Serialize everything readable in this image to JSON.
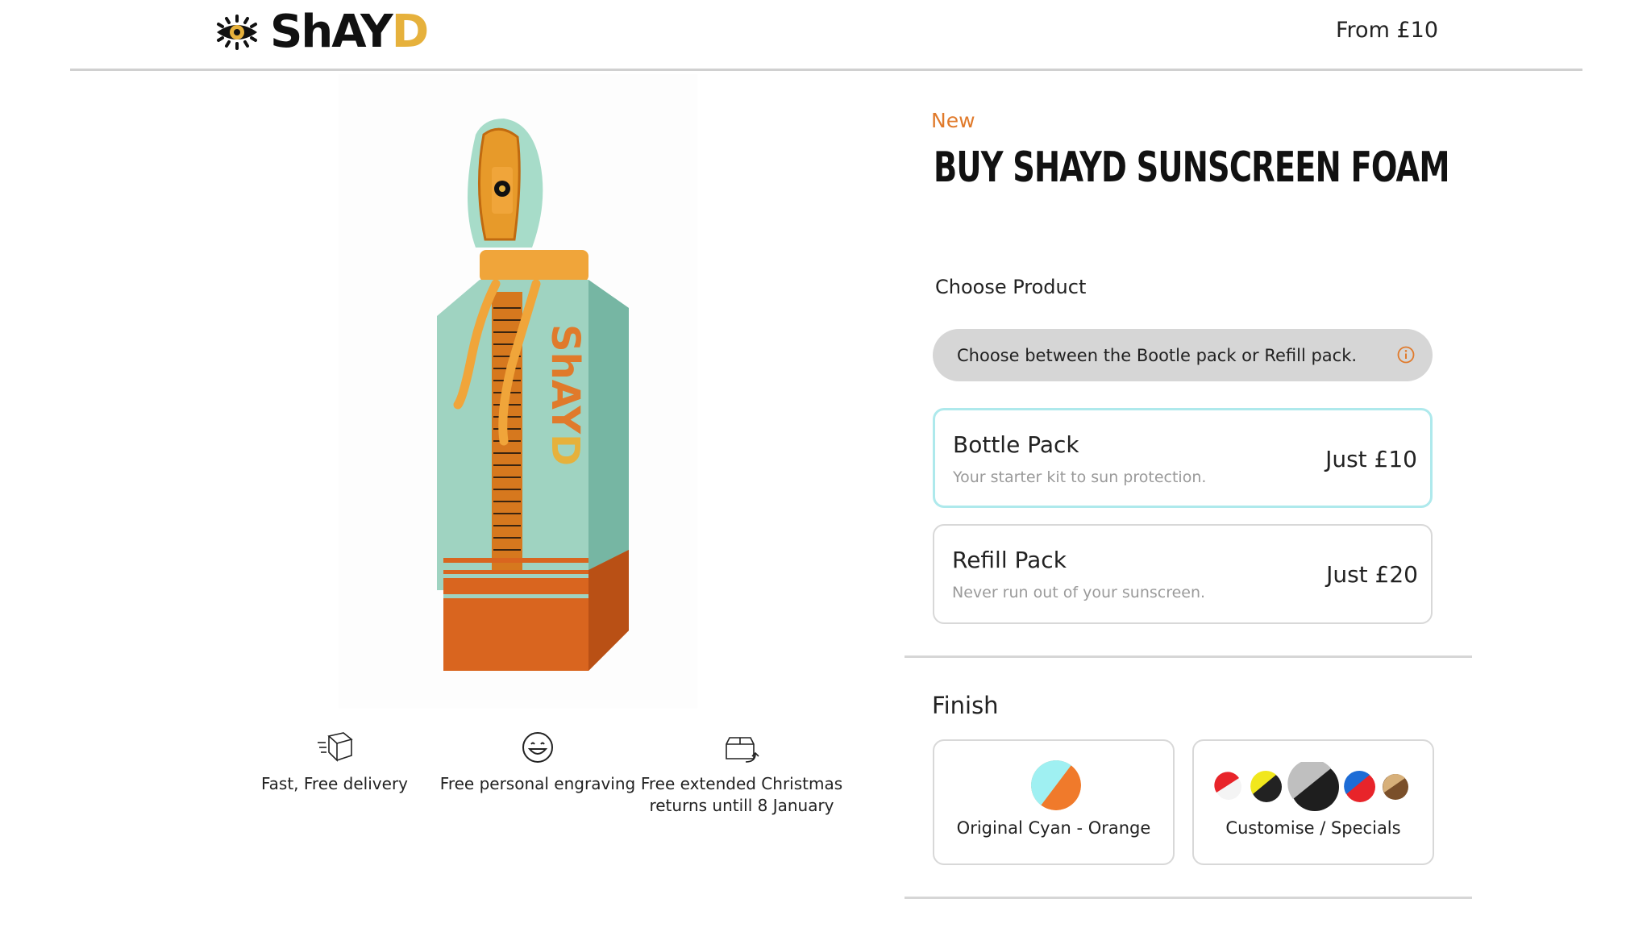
{
  "header": {
    "brand": "ShAYD",
    "brand_main": "ShAY",
    "brand_accent": "D",
    "from_price": "From £10"
  },
  "product": {
    "tag": "New",
    "title": "BUY SHAYD SUNSCREEN FOAM",
    "image_icon": "sunscreen-bottle-image"
  },
  "features": [
    {
      "icon": "delivery-box-icon",
      "line1": "Fast, Free delivery",
      "line2": ""
    },
    {
      "icon": "smiley-face-icon",
      "line1": "Free personal engraving",
      "line2": ""
    },
    {
      "icon": "return-box-icon",
      "line1": "Free extended Christmas",
      "line2": "returns untill 8 January"
    }
  ],
  "choose": {
    "label": "Choose Product",
    "info_text": "Choose between the Bootle pack or Refill pack."
  },
  "packs": [
    {
      "name": "Bottle Pack",
      "desc": "Your starter kit to sun protection.",
      "price": "Just £10",
      "selected": true
    },
    {
      "name": "Refill Pack",
      "desc": "Never run out of your sunscreen.",
      "price": "Just £20",
      "selected": false
    }
  ],
  "finish": {
    "label": "Finish",
    "options": [
      {
        "label": "Original  Cyan - Orange"
      },
      {
        "label": "Customise / Specials"
      }
    ]
  },
  "colors": {
    "accent_orange": "#e07a2b",
    "brand_gold": "#e6b13c",
    "bottle_mint": "#9fd3c1",
    "selected_border": "#aee9ec"
  }
}
